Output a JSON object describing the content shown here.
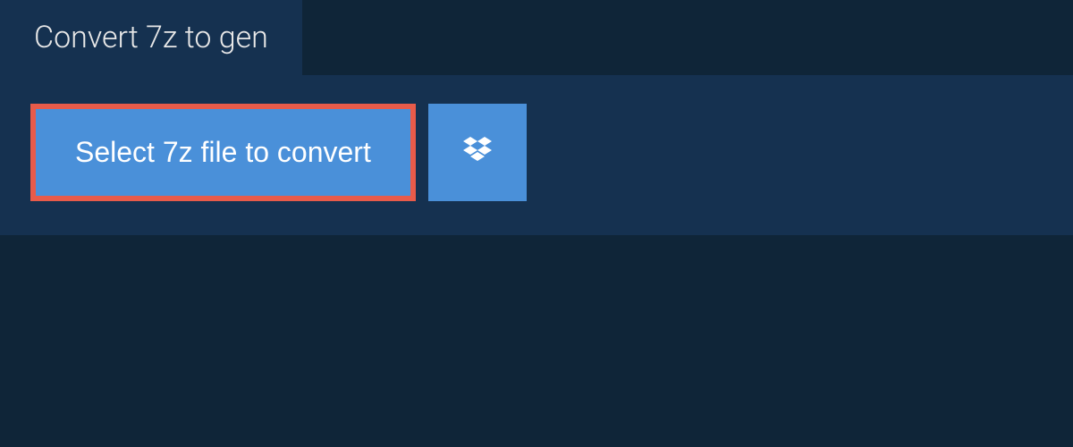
{
  "header": {
    "title": "Convert 7z to gen"
  },
  "actions": {
    "select_file_label": "Select 7z file to convert",
    "dropbox_icon": "dropbox"
  },
  "colors": {
    "page_bg": "#0f2538",
    "panel_bg": "#153150",
    "button_bg": "#4a90d9",
    "highlight_border": "#e85b4a",
    "text": "#ffffff"
  }
}
